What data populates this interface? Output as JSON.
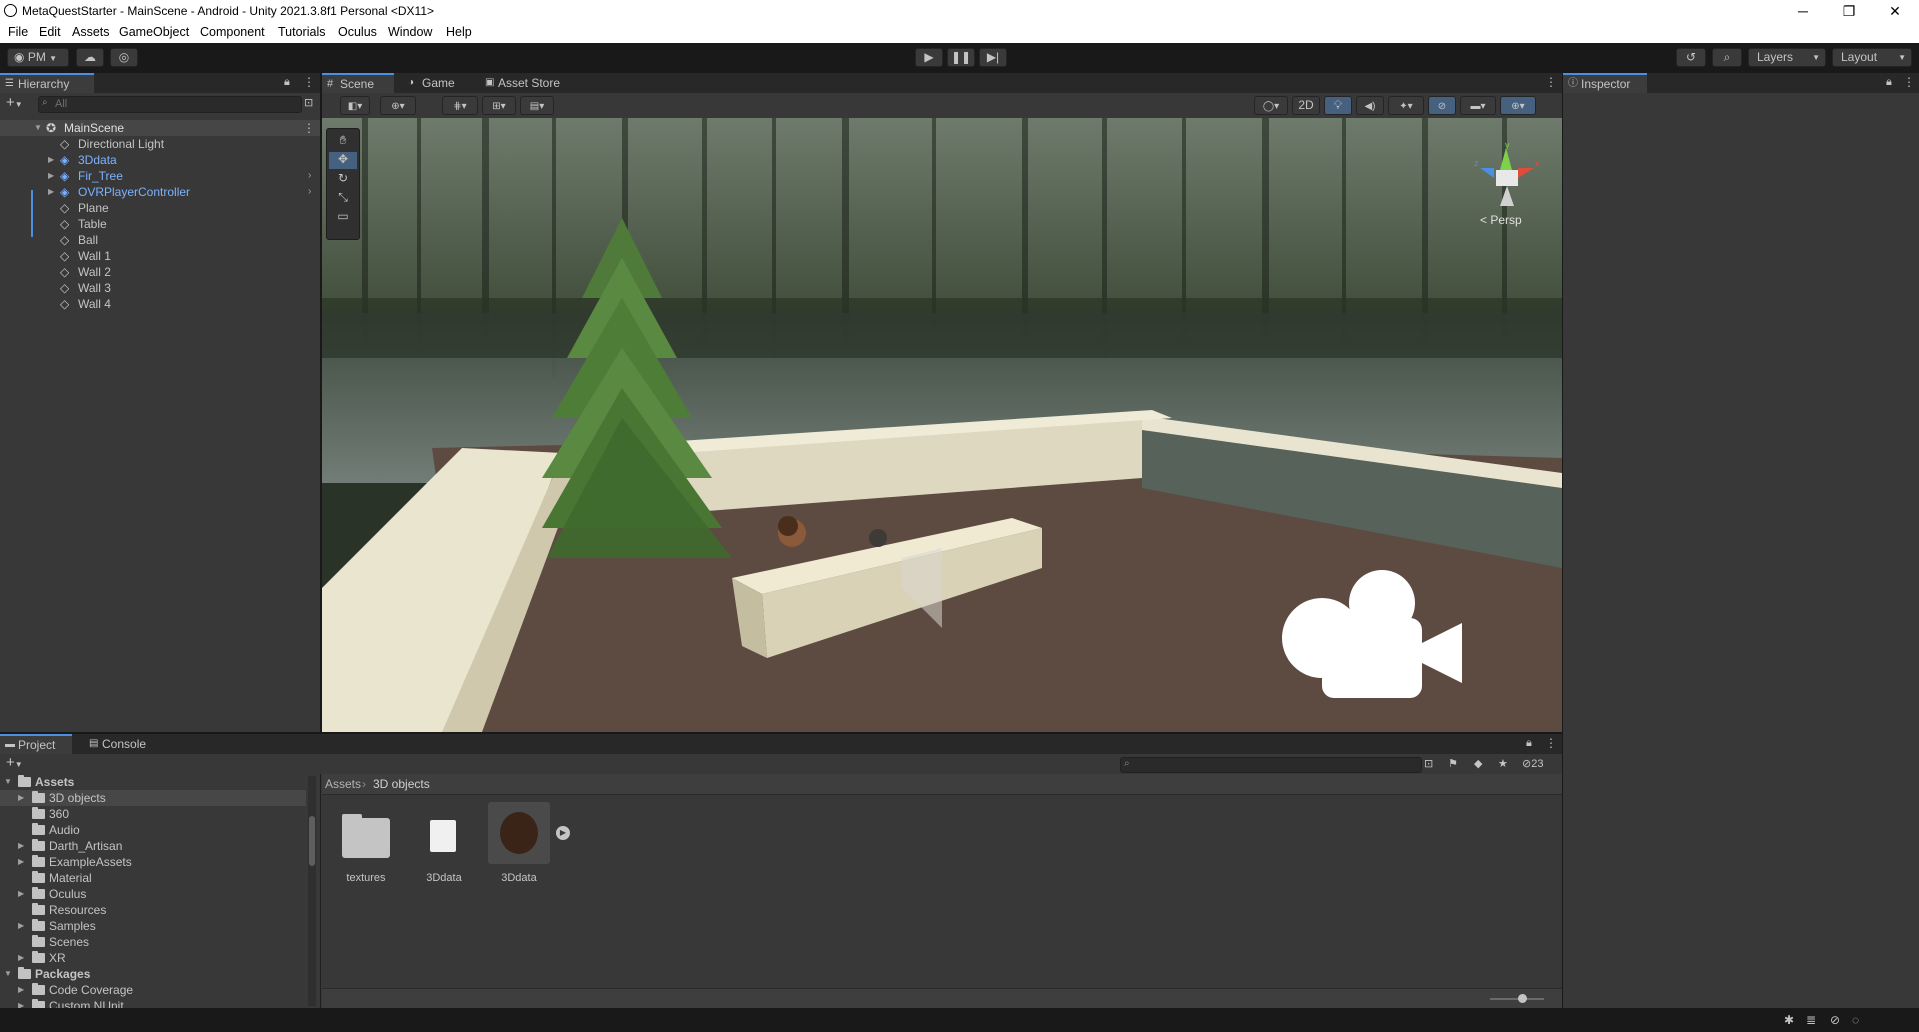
{
  "window": {
    "title": "MetaQuestStarter - MainScene - Android - Unity 2021.3.8f1 Personal <DX11>",
    "controls": [
      "─",
      "❐",
      "✕"
    ]
  },
  "menu": [
    "File",
    "Edit",
    "Assets",
    "GameObject",
    "Component",
    "Tutorials",
    "Oculus",
    "Window",
    "Help"
  ],
  "toolbar": {
    "account": "PM",
    "layers": "Layers",
    "layout": "Layout"
  },
  "hierarchy": {
    "tab": "Hierarchy",
    "search_placeholder": "All",
    "scene": "MainScene",
    "items": [
      {
        "label": "Directional Light",
        "prefab": false,
        "expandable": false
      },
      {
        "label": "3Ddata",
        "prefab": true,
        "expandable": true
      },
      {
        "label": "Fir_Tree",
        "prefab": true,
        "expandable": true
      },
      {
        "label": "OVRPlayerController",
        "prefab": true,
        "expandable": true
      },
      {
        "label": "Plane",
        "prefab": false,
        "expandable": false
      },
      {
        "label": "Table",
        "prefab": false,
        "expandable": false
      },
      {
        "label": "Ball",
        "prefab": false,
        "expandable": false
      },
      {
        "label": "Wall 1",
        "prefab": false,
        "expandable": false
      },
      {
        "label": "Wall 2",
        "prefab": false,
        "expandable": false
      },
      {
        "label": "Wall 3",
        "prefab": false,
        "expandable": false
      },
      {
        "label": "Wall 4",
        "prefab": false,
        "expandable": false
      }
    ]
  },
  "scene_tabs": [
    "Scene",
    "Game",
    "Asset Store"
  ],
  "scene_toolbar": {
    "mode_2d": "2D"
  },
  "scene_view": {
    "projection": "< Persp",
    "gizmo_axes": [
      "x",
      "y",
      "z"
    ]
  },
  "inspector": {
    "tab": "Inspector"
  },
  "project": {
    "tabs": [
      "Project",
      "Console"
    ],
    "breadcrumb": [
      "Assets",
      "3D objects"
    ],
    "hidden_count": "23",
    "tree": [
      {
        "label": "Assets",
        "level": 0,
        "bold": true,
        "expanded": true
      },
      {
        "label": "3D objects",
        "level": 1,
        "expandable": true,
        "selected": true
      },
      {
        "label": "360",
        "level": 1
      },
      {
        "label": "Audio",
        "level": 1
      },
      {
        "label": "Darth_Artisan",
        "level": 1,
        "expandable": true
      },
      {
        "label": "ExampleAssets",
        "level": 1,
        "expandable": true
      },
      {
        "label": "Material",
        "level": 1
      },
      {
        "label": "Oculus",
        "level": 1,
        "expandable": true
      },
      {
        "label": "Resources",
        "level": 1
      },
      {
        "label": "Samples",
        "level": 1,
        "expandable": true
      },
      {
        "label": "Scenes",
        "level": 1
      },
      {
        "label": "XR",
        "level": 1,
        "expandable": true
      },
      {
        "label": "Packages",
        "level": 0,
        "bold": true,
        "expanded": true
      },
      {
        "label": "Code Coverage",
        "level": 1,
        "expandable": true
      },
      {
        "label": "Custom NUnit",
        "level": 1,
        "expandable": true
      }
    ],
    "assets": [
      {
        "label": "textures",
        "kind": "folder"
      },
      {
        "label": "3Ddata",
        "kind": "material"
      },
      {
        "label": "3Ddata",
        "kind": "model"
      }
    ]
  },
  "colors": {
    "accent": "#4a8fe2",
    "prefab_text": "#7cb1ff",
    "panel": "#383838",
    "toolbar": "#191919"
  }
}
